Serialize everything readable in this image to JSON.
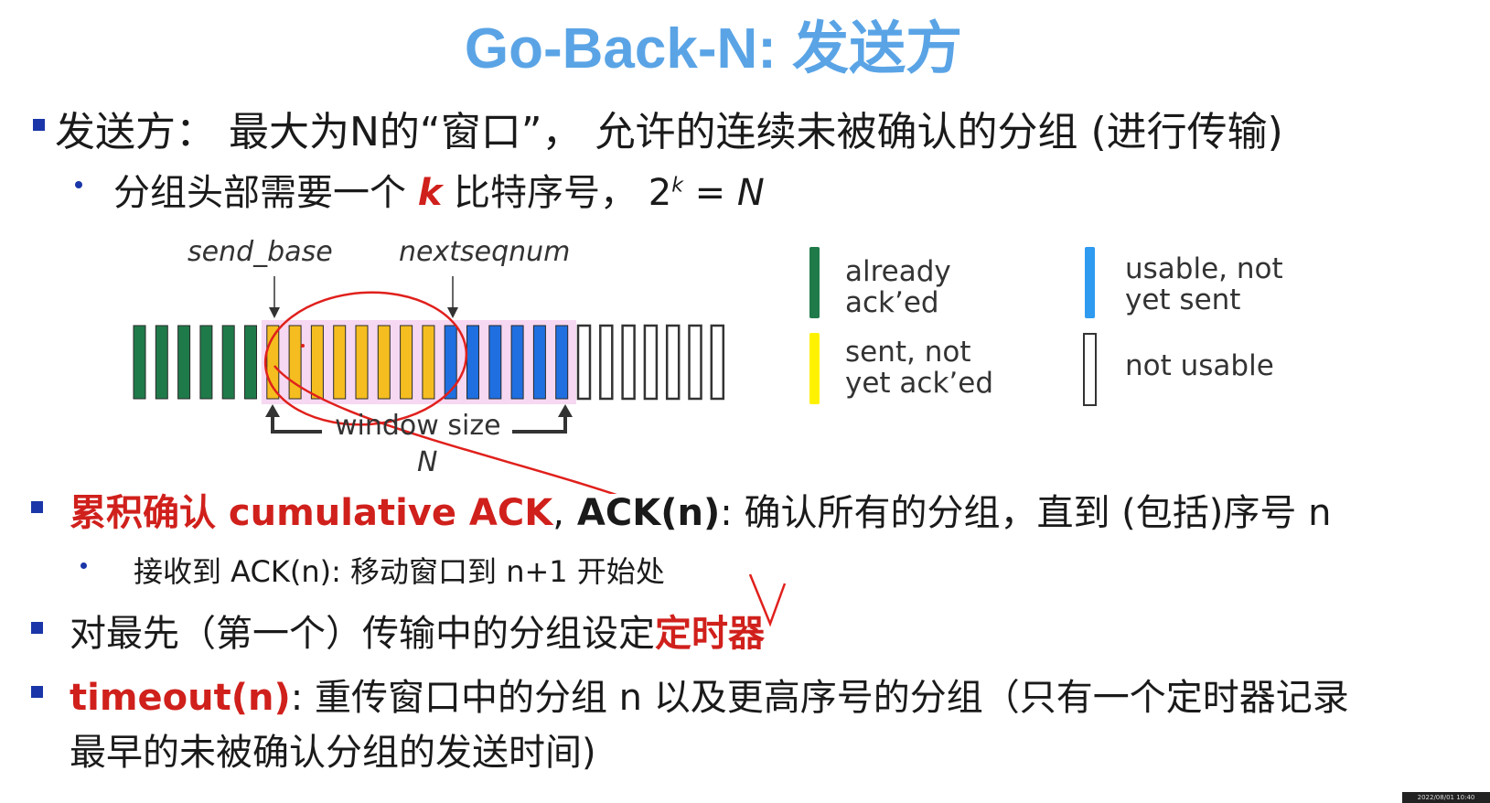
{
  "title": "Go-Back-N: 发送方",
  "bullets": {
    "sender_window": {
      "text": "发送方：  最大为N的“窗口”，  允许的连续未被确认的分组 (进行传输)",
      "sub": {
        "prefix": "分组头部需要一个 ",
        "k": "k",
        "mid": " 比特序号，  2",
        "sup": "k",
        "suffix": " =  N"
      }
    },
    "cumulative_ack": {
      "red_label": "累积确认 cumulative ACK",
      "comma": ",",
      "bold_label": " ACK(n)",
      "rest": ": 确认所有的分组，直到 (包括)序号 n",
      "sub": "接收到 ACK(n): 移动窗口到 n+1 开始处"
    },
    "timer": {
      "text": "对最先（第一个）传输中的分组设定",
      "red": "定时器"
    },
    "timeout": {
      "red_label": "timeout(n)",
      "rest": ": 重传窗口中的分组 n 以及更高序号的分组（只有一个定时器记录",
      "rest2": "最早的未被确认分组的发送时间)"
    }
  },
  "diagram": {
    "send_base": "send_base",
    "nextseqnum": "nextseqnum",
    "window_size": "window size",
    "n_label": "N",
    "segments": {
      "acked": 6,
      "sent_not_acked": 8,
      "usable": 6,
      "not_usable": 7
    },
    "colors": {
      "acked": "#1f7a4a",
      "sent_not_acked": "#f5bd1f",
      "usable": "#1f6fe0",
      "not_usable": "#ffffff",
      "window_highlight": "#f6d8f2",
      "annotation_red": "#e0201c"
    }
  },
  "legend": {
    "already_acked": "already\nack’ed",
    "usable_not_sent": "usable, not\nyet sent",
    "sent_not_acked": "sent, not\nyet ack’ed",
    "not_usable": "not usable",
    "colors": {
      "already_acked": "#1f7a4a",
      "usable_not_sent": "#2e9af0",
      "sent_not_acked": "#fff200",
      "not_usable": "#ffffff"
    }
  },
  "footer": "2022/08/01 10:40"
}
